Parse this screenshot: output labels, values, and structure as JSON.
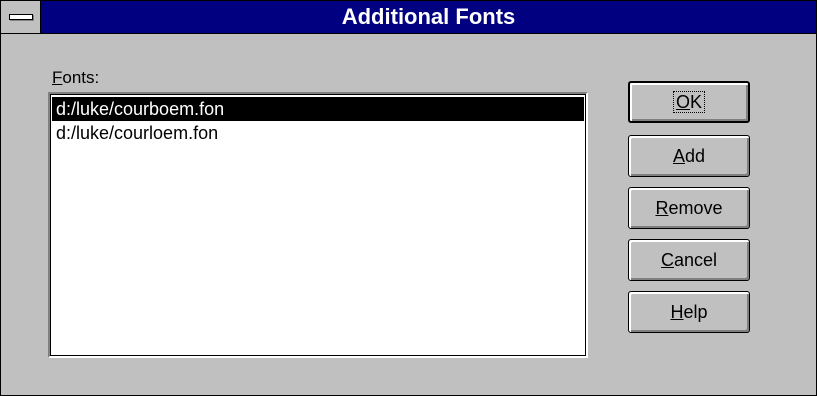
{
  "window": {
    "title": "Additional Fonts"
  },
  "fonts_label": {
    "mnemonic": "F",
    "rest": "onts:"
  },
  "fonts_list": [
    "d:/luke/courboem.fon",
    "d:/luke/courloem.fon"
  ],
  "buttons": {
    "ok": {
      "mnemonic": "O",
      "rest": "K"
    },
    "add": {
      "mnemonic": "A",
      "rest": "dd"
    },
    "remove": {
      "mnemonic": "R",
      "rest": "emove"
    },
    "cancel": {
      "mnemonic": "C",
      "rest": "ancel"
    },
    "help": {
      "mnemonic": "H",
      "rest": "elp"
    }
  },
  "colors": {
    "titlebar": "#000080",
    "dialog_face": "#c0c0c0",
    "selection": "#000000"
  }
}
